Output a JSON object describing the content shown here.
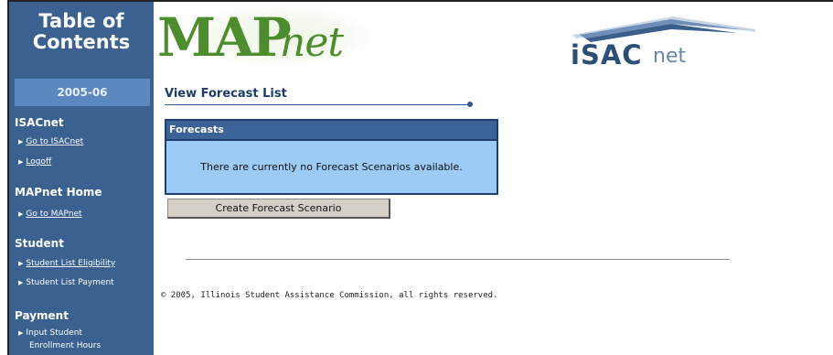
{
  "sidebar": {
    "title_line1": "Table of",
    "title_line2": "Contents",
    "year": "2005-06",
    "sections": [
      {
        "title": "ISACnet",
        "links": [
          "Go to ISACnet",
          "Logoff"
        ]
      },
      {
        "title": "MAPnet Home",
        "links": [
          "Go to MAPnet"
        ]
      },
      {
        "title": "Student",
        "links": [
          "Student List Eligibility",
          "Student List Payment"
        ]
      },
      {
        "title": "Payment",
        "links": [
          "Input Student",
          "Enrollment Hours"
        ]
      }
    ]
  },
  "logos": {
    "map_big": "MAP",
    "map_small": "net",
    "isac_word": "iSAC",
    "isac_net": "net"
  },
  "main": {
    "heading": "View Forecast List",
    "panel_title": "Forecasts",
    "panel_message": "There are currently no Forecast Scenarios available.",
    "create_button": "Create Forecast Scenario"
  },
  "footer": {
    "copyright": "© 2005, Illinois Student Assistance Commission, all rights reserved."
  },
  "colors": {
    "sidebar_bg": "#3a6190",
    "year_box": "#5b88be",
    "panel_header": "#3c6398",
    "panel_body": "#9ccbf7",
    "map_green": "#4e8d2e",
    "isac_blue": "#2c4f78"
  }
}
